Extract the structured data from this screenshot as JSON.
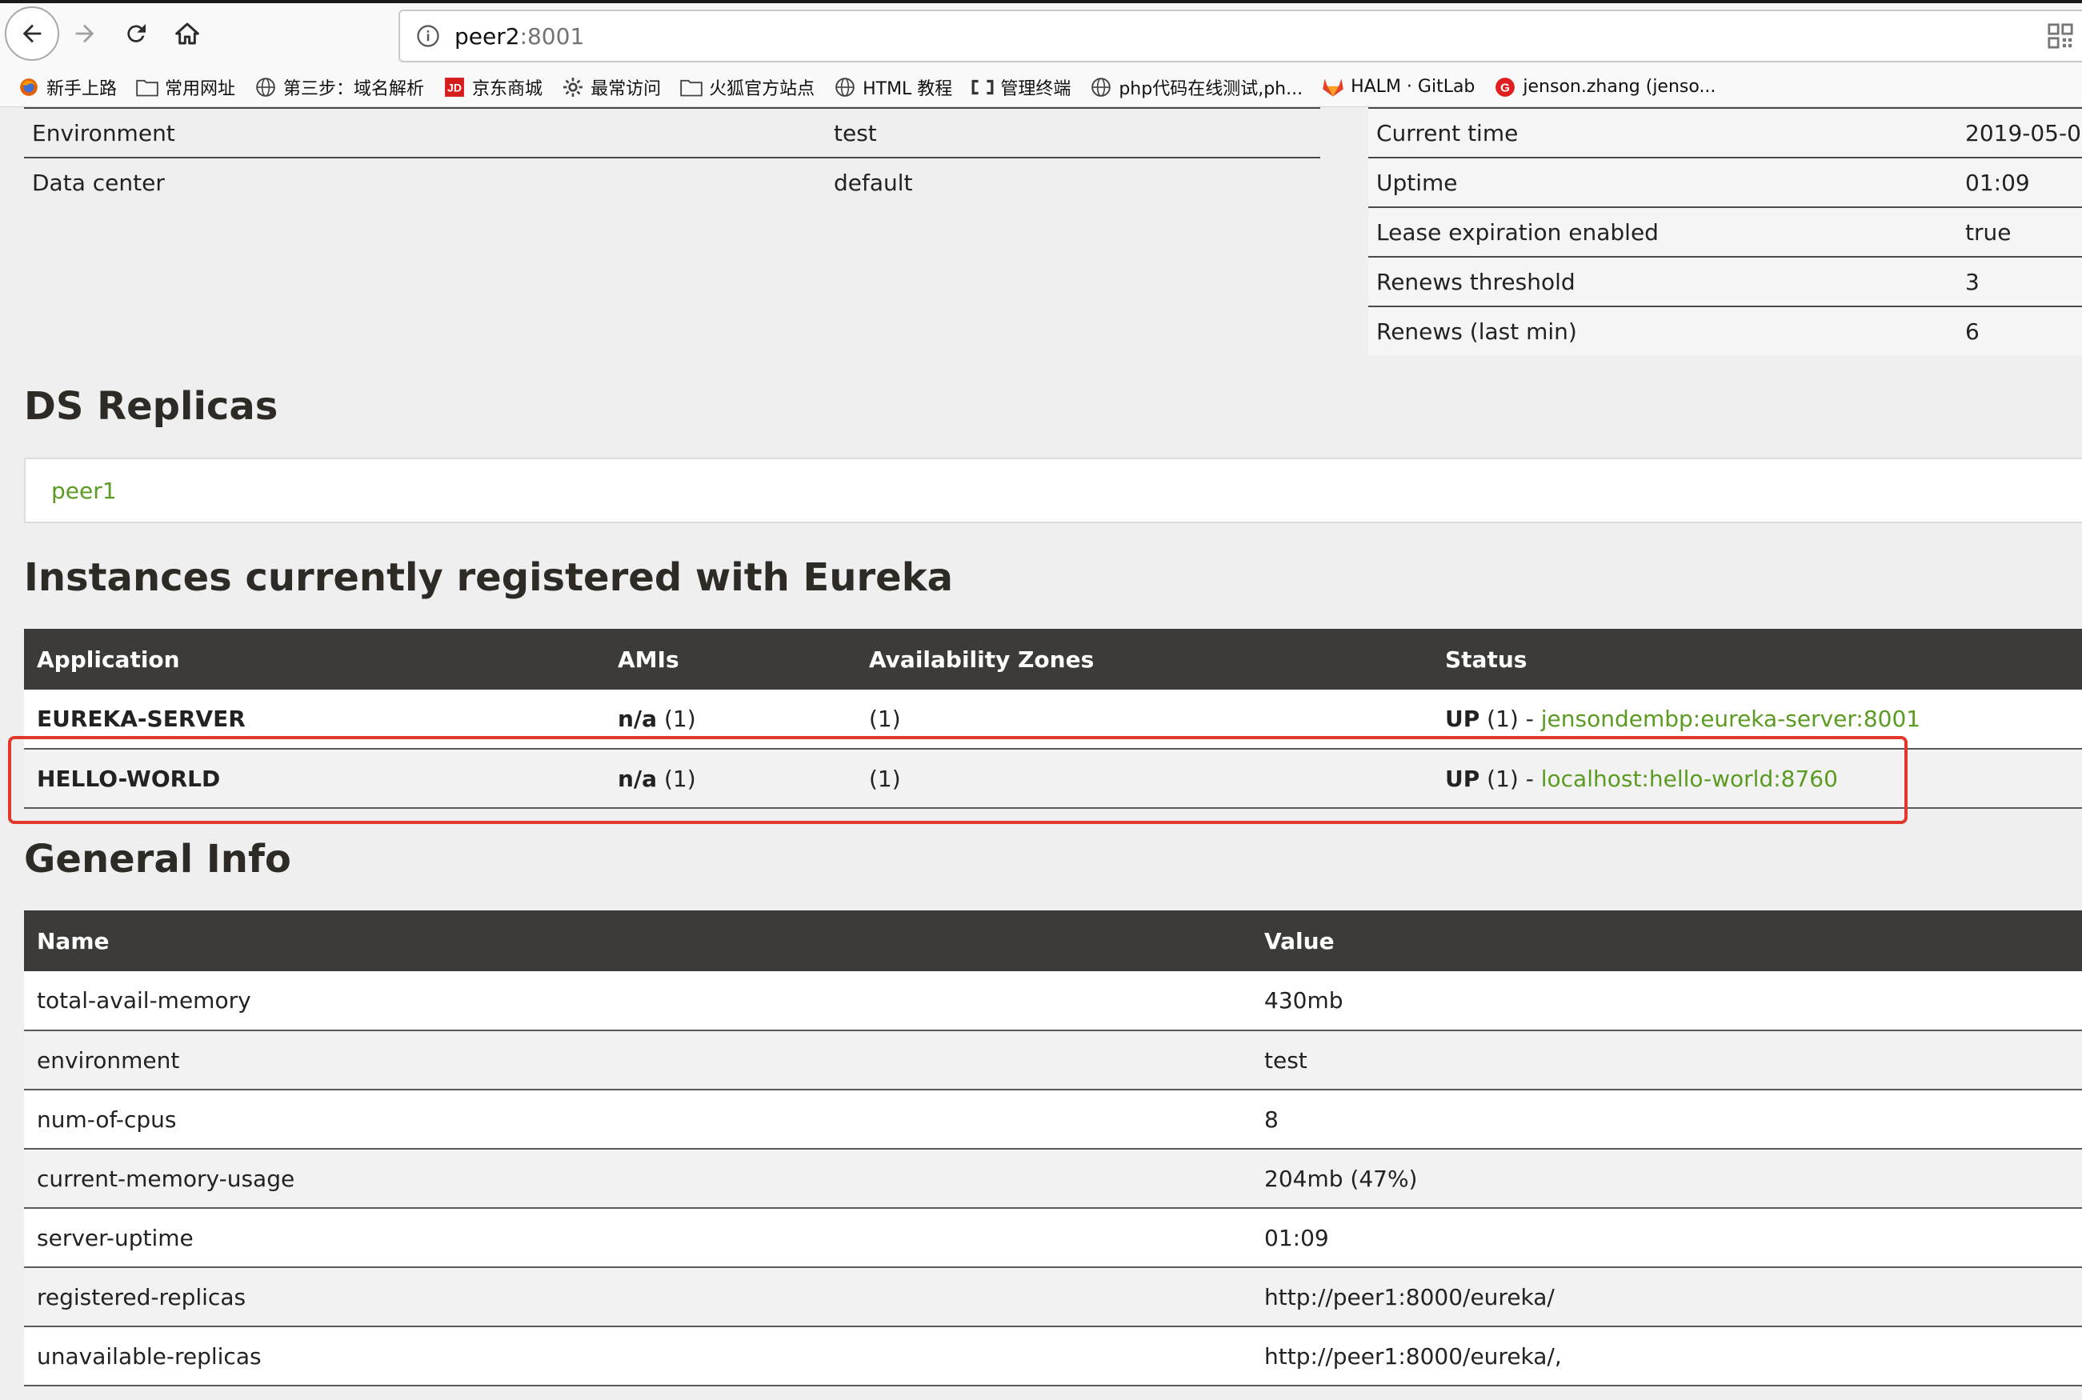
{
  "browser": {
    "url_host": "peer2",
    "url_port": ":8001",
    "bookmarks": [
      {
        "label": "新手上路",
        "icon": "firefox-icon"
      },
      {
        "label": "常用网址",
        "icon": "folder-icon"
      },
      {
        "label": "第三步：域名解析",
        "icon": "globe-icon"
      },
      {
        "label": "京东商城",
        "icon": "jd-icon"
      },
      {
        "label": "最常访问",
        "icon": "gear-icon"
      },
      {
        "label": "火狐官方站点",
        "icon": "folder-icon"
      },
      {
        "label": "HTML 教程",
        "icon": "globe-icon"
      },
      {
        "label": "管理终端",
        "icon": "terminal-icon"
      },
      {
        "label": "php代码在线测试,ph...",
        "icon": "globe-icon"
      },
      {
        "label": "HALM · GitLab",
        "icon": "gitlab-icon"
      },
      {
        "label": "jenson.zhang (jenso...",
        "icon": "g-icon"
      }
    ]
  },
  "system_left": [
    {
      "key": "Environment",
      "value": "test"
    },
    {
      "key": "Data center",
      "value": "default"
    }
  ],
  "system_right": [
    {
      "key": "Current time",
      "value": "2019-05-0"
    },
    {
      "key": "Uptime",
      "value": "01:09"
    },
    {
      "key": "Lease expiration enabled",
      "value": "true"
    },
    {
      "key": "Renews threshold",
      "value": "3"
    },
    {
      "key": "Renews (last min)",
      "value": "6"
    }
  ],
  "replicas": {
    "title": "DS Replicas",
    "items": [
      "peer1"
    ]
  },
  "instances": {
    "title": "Instances currently registered with Eureka",
    "headers": [
      "Application",
      "AMIs",
      "Availability Zones",
      "Status"
    ],
    "rows": [
      {
        "application": "EUREKA-SERVER",
        "amis_bold": "n/a",
        "amis_count": " (1)",
        "zones": "(1)",
        "status_prefix_bold": "UP",
        "status_count": " (1) - ",
        "status_link": "jensondembp:eureka-server:8001"
      },
      {
        "application": "HELLO-WORLD",
        "amis_bold": "n/a",
        "amis_count": " (1)",
        "zones": "(1)",
        "status_prefix_bold": "UP",
        "status_count": " (1) - ",
        "status_link": "localhost:hello-world:8760"
      }
    ]
  },
  "general": {
    "title": "General Info",
    "headers": [
      "Name",
      "Value"
    ],
    "rows": [
      {
        "name": "total-avail-memory",
        "value": "430mb"
      },
      {
        "name": "environment",
        "value": "test"
      },
      {
        "name": "num-of-cpus",
        "value": "8"
      },
      {
        "name": "current-memory-usage",
        "value": "204mb (47%)"
      },
      {
        "name": "server-uptime",
        "value": "01:09"
      },
      {
        "name": "registered-replicas",
        "value": "http://peer1:8000/eureka/"
      },
      {
        "name": "unavailable-replicas",
        "value": "http://peer1:8000/eureka/,"
      }
    ]
  },
  "colors": {
    "link_green": "#5b9b21",
    "table_header": "#3d3b37",
    "highlight_red": "#e2382c"
  }
}
